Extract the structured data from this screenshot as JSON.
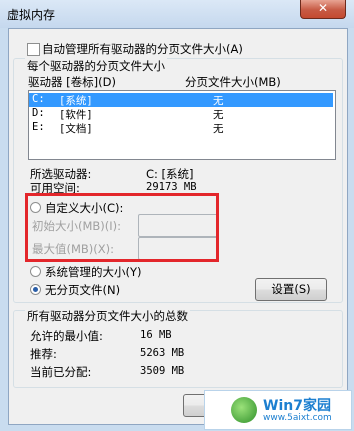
{
  "window": {
    "title": "虚拟内存",
    "close_glyph": "✕"
  },
  "auto_manage": {
    "label": "自动管理所有驱动器的分页文件大小(A)",
    "checked": false
  },
  "drives_group": {
    "legend": "每个驱动器的分页文件大小",
    "col_drive": "驱动器 [卷标](D)",
    "col_size": "分页文件大小(MB)",
    "rows": [
      {
        "drive": "C:",
        "label": "[系统]",
        "size": "无"
      },
      {
        "drive": "D:",
        "label": "[软件]",
        "size": "无"
      },
      {
        "drive": "E:",
        "label": "[文档]",
        "size": "无"
      }
    ],
    "selected_drive_label": "所选驱动器:",
    "selected_drive_value": "C:  [系统]",
    "free_space_label": "可用空间:",
    "free_space_value": "29173 MB",
    "custom_size_label": "自定义大小(C):",
    "initial_size_label": "初始大小(MB)(I):",
    "initial_size_value": "",
    "max_size_label": "最大值(MB)(X):",
    "max_size_value": "",
    "system_managed_label": "系统管理的大小(Y)",
    "no_paging_label": "无分页文件(N)",
    "selected_option": "no_paging",
    "set_button": "设置(S)"
  },
  "totals_group": {
    "legend": "所有驱动器分页文件大小的总数",
    "min_allowed_label": "允许的最小值:",
    "min_allowed_value": "16 MB",
    "recommended_label": "推荐:",
    "recommended_value": "5263 MB",
    "current_label": "当前已分配:",
    "current_value": "3509 MB"
  },
  "watermark": {
    "title": "Win7家园",
    "url": "www.5aixt.com"
  },
  "colors": {
    "highlight": "#3399ff",
    "annotation_box": "#e3262b"
  }
}
